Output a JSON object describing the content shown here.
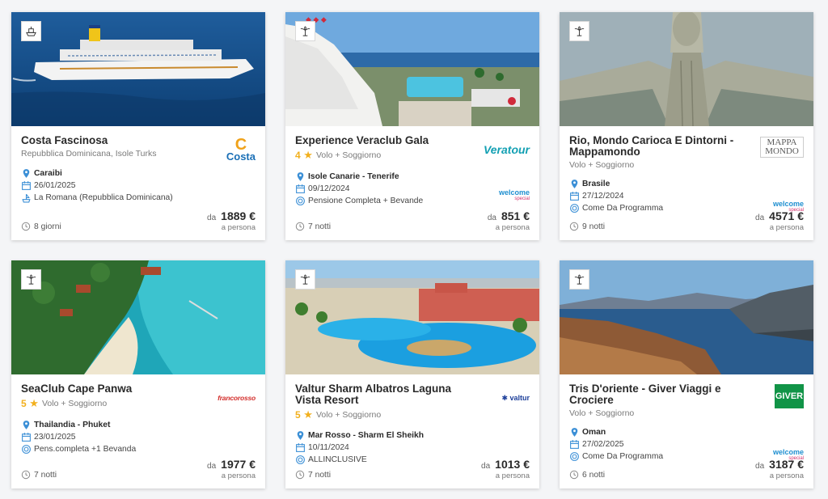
{
  "cards": [
    {
      "title": "Costa Fascinosa",
      "subtitle": "Repubblica Dominicana, Isole Turks",
      "stars": "",
      "brand": "Costa",
      "brand_secondary": "",
      "destination": "Caraibi",
      "date": "26/01/2025",
      "extra": "La Romana (Repubblica Dominicana)",
      "extra_icon": "port-icon",
      "duration": "8 giorni",
      "price_prefix": "da",
      "price": "1889 €",
      "price_suffix": "a persona"
    },
    {
      "title": "Experience Veraclub Gala",
      "subtitle": "Volo + Soggiorno",
      "stars": "4",
      "brand": "Veratour",
      "brand_secondary": "welcome",
      "destination": "Isole Canarie - Tenerife",
      "date": "09/12/2024",
      "extra": "Pensione Completa + Bevande",
      "extra_icon": "meal-icon",
      "duration": "7 notti",
      "price_prefix": "da",
      "price": "851 €",
      "price_suffix": "a persona"
    },
    {
      "title": "Rio, Mondo Carioca E Dintorni - Mappamondo",
      "subtitle": "Volo + Soggiorno",
      "stars": "",
      "brand": "MAPPA MONDO",
      "brand_secondary": "welcome",
      "destination": "Brasile",
      "date": "27/12/2024",
      "extra": "Come Da Programma",
      "extra_icon": "meal-icon",
      "duration": "9 notti",
      "price_prefix": "da",
      "price": "4571 €",
      "price_suffix": "a persona"
    },
    {
      "title": "SeaClub Cape Panwa",
      "subtitle": "Volo + Soggiorno",
      "stars": "5",
      "brand": "francorosso",
      "brand_secondary": "",
      "destination": "Thailandia - Phuket",
      "date": "23/01/2025",
      "extra": "Pens.completa +1 Bevanda",
      "extra_icon": "meal-icon",
      "duration": "7 notti",
      "price_prefix": "da",
      "price": "1977 €",
      "price_suffix": "a persona"
    },
    {
      "title": "Valtur Sharm Albatros Laguna Vista Resort",
      "subtitle": "Volo + Soggiorno",
      "stars": "5",
      "brand": "valtur",
      "brand_secondary": "",
      "destination": "Mar Rosso - Sharm El Sheikh",
      "date": "10/11/2024",
      "extra": "ALLINCLUSIVE",
      "extra_icon": "meal-icon",
      "duration": "7 notti",
      "price_prefix": "da",
      "price": "1013 €",
      "price_suffix": "a persona"
    },
    {
      "title": "Tris D'oriente - Giver Viaggi e Crociere",
      "subtitle": "Volo + Soggiorno",
      "stars": "",
      "brand": "GIVER",
      "brand_secondary": "welcome",
      "destination": "Oman",
      "date": "27/02/2025",
      "extra": "Come Da Programma",
      "extra_icon": "meal-icon",
      "duration": "6 notti",
      "price_prefix": "da",
      "price": "3187 €",
      "price_suffix": "a persona"
    }
  ],
  "welcome_logo": {
    "main": "welcome",
    "sub": "special"
  },
  "colors": {
    "accent": "#3b8fd6",
    "star": "#f2b01e",
    "card_bg": "#ffffff",
    "page_bg": "#f4f5f7"
  }
}
